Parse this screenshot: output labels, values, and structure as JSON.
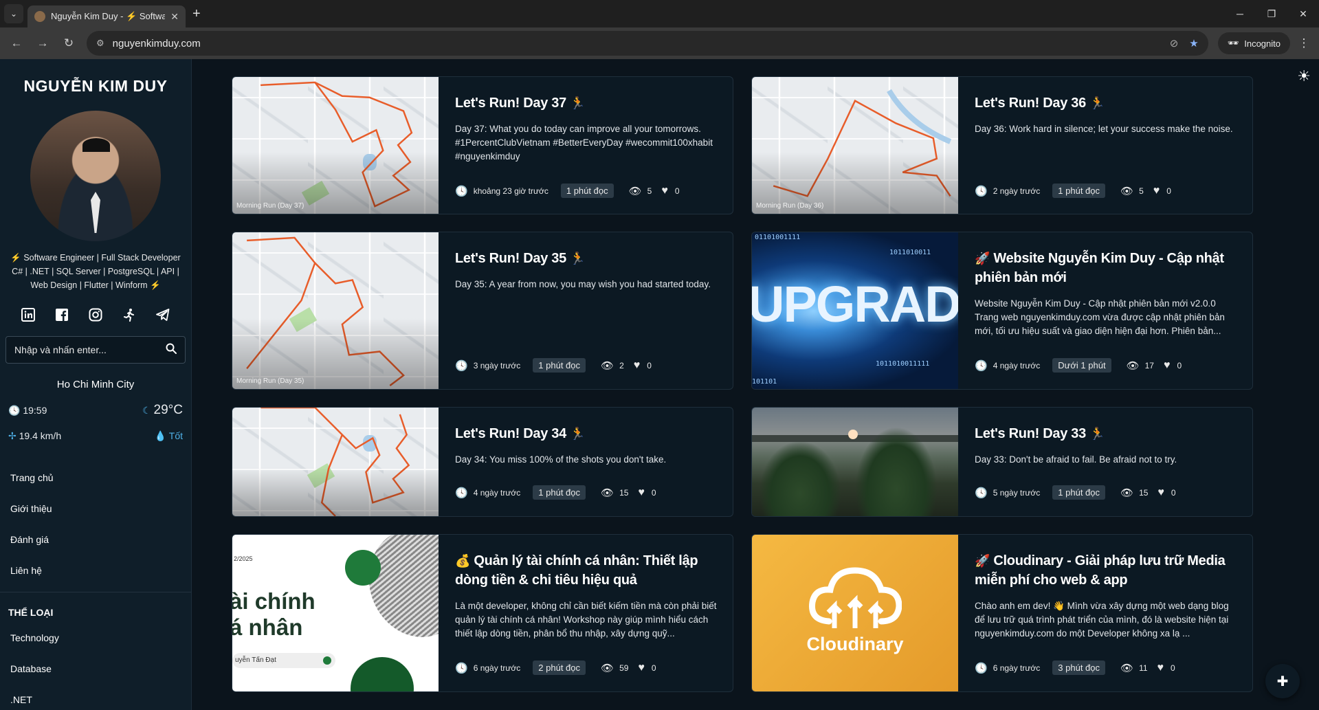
{
  "browser": {
    "tab_title": "Nguyễn Kim Duy - ⚡ Software",
    "url": "nguyenkimduy.com",
    "incognito_label": "Incognito"
  },
  "sidebar": {
    "name": "NGUYỄN KIM DUY",
    "bio": "Software Engineer | Full Stack Developer C# | .NET | SQL Server | PostgreSQL | API | Web Design | Flutter | Winform",
    "search_placeholder": "Nhập và nhấn enter...",
    "city": "Ho Chi Minh City",
    "time": "19:59",
    "temperature": "29°C",
    "wind": "19.4 km/h",
    "air_quality": "Tốt",
    "menu": [
      "Trang chủ",
      "Giới thiệu",
      "Đánh giá",
      "Liên hệ"
    ],
    "category_heading": "THỂ LOẠI",
    "categories": [
      "Technology",
      "Database",
      ".NET"
    ]
  },
  "posts": [
    {
      "title": "Let's Run! Day 37",
      "excerpt": "Day 37: What you do today can improve all your tomorrows. #1PercentClubVietnam #BetterEveryDay #wecommit100xhabit #nguyenkimduy",
      "time": "khoảng 23 giờ trước",
      "read": "1 phút đọc",
      "views": "5",
      "likes": "0",
      "thumb_caption": "Morning Run (Day 37)"
    },
    {
      "title": "Let's Run! Day 36",
      "excerpt": "Day 36: Work hard in silence; let your success make the noise.",
      "time": "2 ngày trước",
      "read": "1 phút đọc",
      "views": "5",
      "likes": "0",
      "thumb_caption": "Morning Run (Day 36)"
    },
    {
      "title": "Let's Run! Day 35",
      "excerpt": "Day 35: A year from now, you may wish you had started today.",
      "time": "3 ngày trước",
      "read": "1 phút đọc",
      "views": "2",
      "likes": "0",
      "thumb_caption": "Morning Run (Day 35)"
    },
    {
      "title": "Website Nguyễn Kim Duy - Cập nhật phiên bản mới",
      "excerpt": "Website Nguyễn Kim Duy - Cập nhật phiên bản mới v2.0.0 Trang web nguyenkimduy.com vừa được cập nhật phiên bản mới, tối ưu hiệu suất và giao diện hiện đại hơn. Phiên bản...",
      "time": "4 ngày trước",
      "read": "Dưới 1 phút",
      "views": "17",
      "likes": "0",
      "thumb_text": "UPGRAD"
    },
    {
      "title": "Let's Run! Day 34",
      "excerpt": "Day 34: You miss 100% of the shots you don't take.",
      "time": "4 ngày trước",
      "read": "1 phút đọc",
      "views": "15",
      "likes": "0"
    },
    {
      "title": "Let's Run! Day 33",
      "excerpt": "Day 33: Don't be afraid to fail. Be afraid not to try.",
      "time": "5 ngày trước",
      "read": "1 phút đọc",
      "views": "15",
      "likes": "0"
    },
    {
      "title": "Quản lý tài chính cá nhân: Thiết lập dòng tiền & chi tiêu hiệu quả",
      "excerpt": "Là một developer, không chỉ cần biết kiếm tiền mà còn phải biết quản lý tài chính cá nhân! Workshop này giúp mình hiểu cách thiết lập dòng tiền, phân bổ thu nhập, xây dựng quỹ...",
      "time": "6 ngày trước",
      "read": "2 phút đọc",
      "views": "59",
      "likes": "0",
      "thumb_date": "2/2025",
      "thumb_text_1": "ài chính",
      "thumb_text_2": "á nhân",
      "thumb_author": "uyễn Tấn Đạt"
    },
    {
      "title": "Cloudinary - Giải pháp lưu trữ Media miễn phí cho web & app",
      "excerpt": "Chào anh em dev! 👋 Mình vừa xây dựng một web dạng blog để lưu trữ quá trình phát triển của mình, đó là website hiện tại nguyenkimduy.com do một Developer không xa lạ ...",
      "time": "6 ngày trước",
      "read": "3 phút đọc",
      "views": "11",
      "likes": "0",
      "thumb_text": "Cloudinary"
    }
  ],
  "colors": {
    "accent_orange": "#f4a23b",
    "bg": "#0b141c",
    "card": "#0c1923"
  }
}
